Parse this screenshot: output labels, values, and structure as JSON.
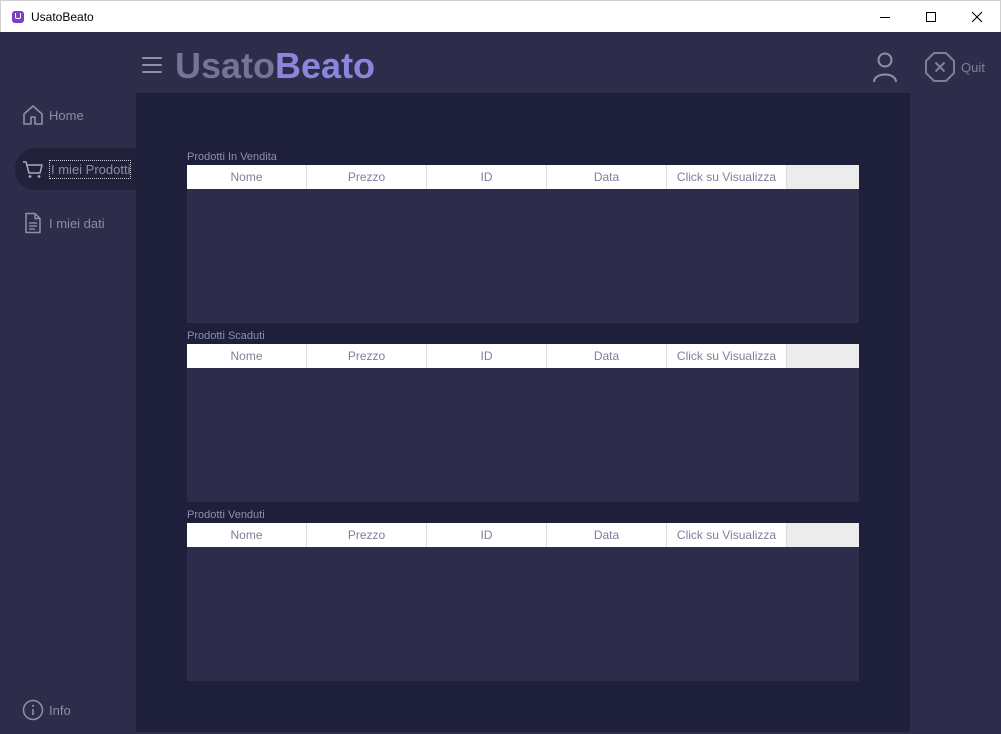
{
  "window": {
    "title": "UsatoBeato"
  },
  "header": {
    "brand_part1": "Usato",
    "brand_part2": "Beato",
    "quit_label": "Quit"
  },
  "sidebar": {
    "items": [
      {
        "label": "Home",
        "icon": "home-icon"
      },
      {
        "label": "I miei Prodotti",
        "icon": "cart-icon"
      },
      {
        "label": "I miei dati",
        "icon": "document-icon"
      }
    ],
    "info_label": "Info"
  },
  "sections": [
    {
      "title": "Prodotti In Vendita",
      "columns": [
        "Nome",
        "Prezzo",
        "ID",
        "Data",
        "Click su Visualizza"
      ],
      "rows": []
    },
    {
      "title": "Prodotti Scaduti",
      "columns": [
        "Nome",
        "Prezzo",
        "ID",
        "Data",
        "Click su Visualizza"
      ],
      "rows": []
    },
    {
      "title": "Prodotti Venduti",
      "columns": [
        "Nome",
        "Prezzo",
        "ID",
        "Data",
        "Click su Visualizza"
      ],
      "rows": []
    }
  ],
  "colors": {
    "background": "#2d2c4a",
    "panel": "#1d1f3b",
    "brand_light": "#757398",
    "brand_accent": "#8b86dc"
  }
}
